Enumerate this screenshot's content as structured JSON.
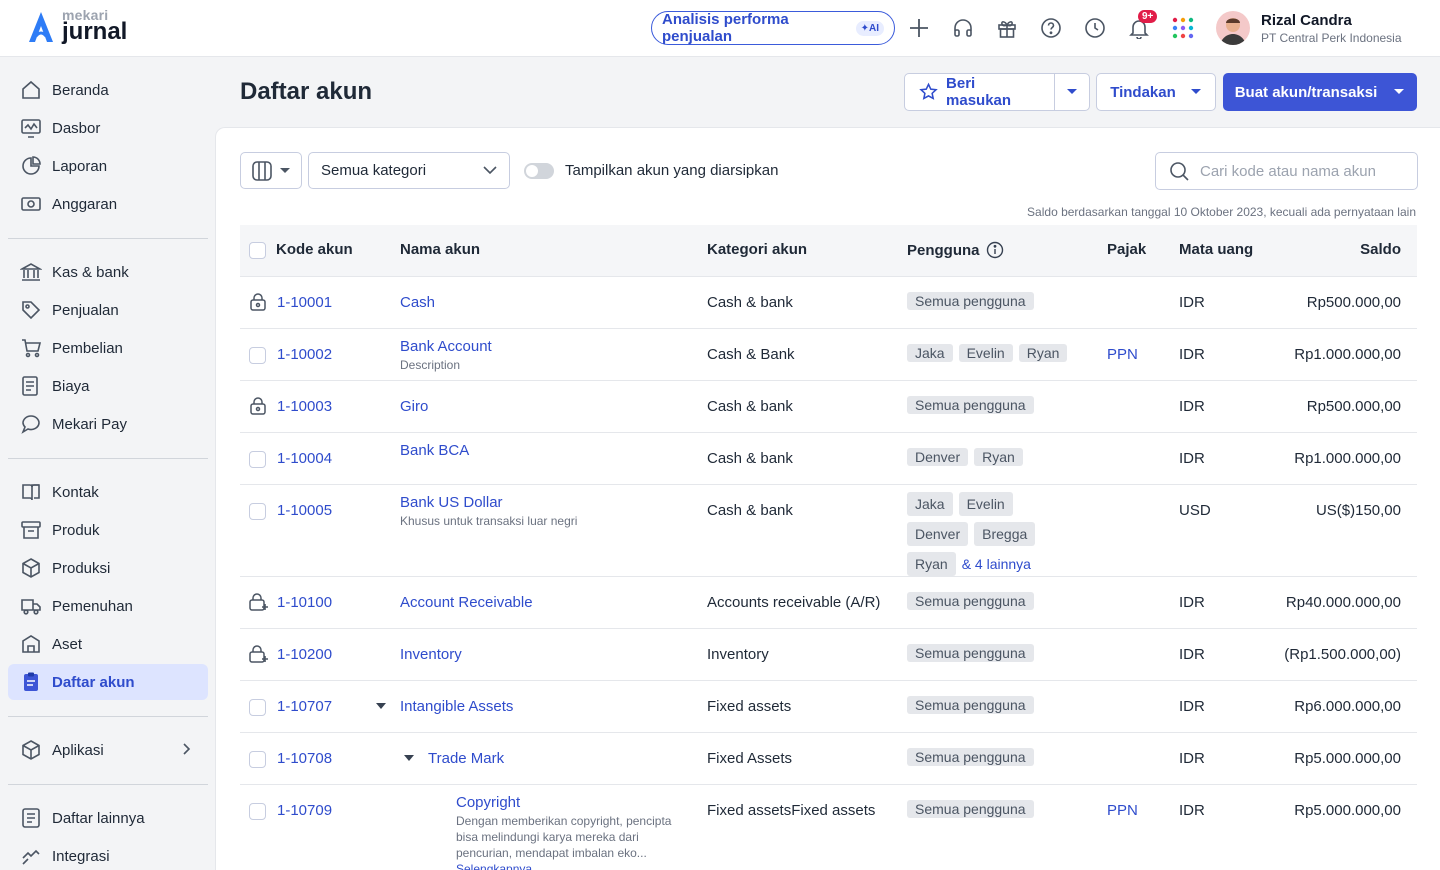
{
  "header": {
    "logo_small": "mekari",
    "logo_big": "jurnal",
    "ai_label": "Analisis performa penjualan",
    "ai_badge": "✦AI",
    "notif_count": "9+",
    "user_name": "Rizal Candra",
    "user_company": "PT Central Perk Indonesia"
  },
  "sidebar": {
    "items": [
      {
        "label": "Beranda",
        "icon": "home-icon"
      },
      {
        "label": "Dasbor",
        "icon": "dashboard-icon"
      },
      {
        "label": "Laporan",
        "icon": "report-icon"
      },
      {
        "label": "Anggaran",
        "icon": "budget-icon"
      },
      {
        "label": "Kas & bank",
        "icon": "bank-icon"
      },
      {
        "label": "Penjualan",
        "icon": "sales-tag-icon"
      },
      {
        "label": "Pembelian",
        "icon": "cart-icon"
      },
      {
        "label": "Biaya",
        "icon": "expense-icon"
      },
      {
        "label": "Mekari Pay",
        "icon": "chat-pay-icon"
      },
      {
        "label": "Kontak",
        "icon": "contact-book-icon"
      },
      {
        "label": "Produk",
        "icon": "product-box-icon"
      },
      {
        "label": "Produksi",
        "icon": "production-cube-icon"
      },
      {
        "label": "Pemenuhan",
        "icon": "truck-icon"
      },
      {
        "label": "Aset",
        "icon": "asset-building-icon"
      },
      {
        "label": "Daftar akun",
        "icon": "clipboard-icon"
      },
      {
        "label": "Aplikasi",
        "icon": "apps-cube-icon"
      },
      {
        "label": "Daftar lainnya",
        "icon": "list-doc-icon"
      },
      {
        "label": "Integrasi",
        "icon": "integration-icon"
      }
    ]
  },
  "page": {
    "title": "Daftar akun",
    "feedback_label": "Beri masukan",
    "actions_label": "Tindakan",
    "create_label": "Buat akun/transaksi"
  },
  "filters": {
    "category": "Semua kategori",
    "archive_toggle_label": "Tampilkan akun yang diarsipkan",
    "archive_toggle_on": false,
    "search_placeholder": "Cari kode atau nama akun",
    "balance_note": "Saldo berdasarkan tanggal 10 Oktober 2023, kecuali ada pernyataan lain"
  },
  "table": {
    "columns": {
      "code": "Kode akun",
      "name": "Nama akun",
      "category": "Kategori akun",
      "users": "Pengguna",
      "tax": "Pajak",
      "currency": "Mata uang",
      "balance": "Saldo"
    },
    "rows": [
      {
        "code": "1-10001",
        "name": "Cash",
        "desc": "",
        "category": "Cash & bank",
        "users": [
          "Semua pengguna"
        ],
        "more": "",
        "tax": "",
        "currency": "IDR",
        "balance": "Rp500.000,00",
        "marker": "lock"
      },
      {
        "code": "1-10002",
        "name": "Bank Account",
        "desc": "Description",
        "category": "Cash & Bank",
        "users": [
          "Jaka",
          "Evelin",
          "Ryan"
        ],
        "more": "",
        "tax": "PPN",
        "currency": "IDR",
        "balance": "Rp1.000.000,00",
        "marker": "checkbox"
      },
      {
        "code": "1-10003",
        "name": "Giro",
        "desc": "",
        "category": "Cash & bank",
        "users": [
          "Semua pengguna"
        ],
        "more": "",
        "tax": "",
        "currency": "IDR",
        "balance": "Rp500.000,00",
        "marker": "lock"
      },
      {
        "code": "1-10004",
        "name": "Bank BCA",
        "desc": "",
        "category": "Cash & bank",
        "users": [
          "Denver",
          "Ryan"
        ],
        "more": "",
        "tax": "",
        "currency": "IDR",
        "balance": "Rp1.000.000,00",
        "marker": "checkbox"
      },
      {
        "code": "1-10005",
        "name": "Bank US Dollar",
        "desc": "Khusus untuk transaksi luar negri",
        "category": "Cash & bank",
        "users": [
          "Jaka",
          "Evelin",
          "Denver",
          "Bregga",
          "Ryan"
        ],
        "more": "& 4 lainnya",
        "tax": "",
        "currency": "USD",
        "balance": "US($)150,00",
        "marker": "checkbox"
      },
      {
        "code": "1-10100",
        "name": "Account Receivable",
        "desc": "",
        "category": "Accounts receivable (A/R)",
        "users": [
          "Semua pengguna"
        ],
        "more": "",
        "tax": "",
        "currency": "IDR",
        "balance": "Rp40.000.000,00",
        "marker": "lock-plus"
      },
      {
        "code": "1-10200",
        "name": "Inventory",
        "desc": "",
        "category": "Inventory",
        "users": [
          "Semua pengguna"
        ],
        "more": "",
        "tax": "",
        "currency": "IDR",
        "balance": "(Rp1.500.000,00)",
        "marker": "lock-plus"
      },
      {
        "code": "1-10707",
        "name": "Intangible Assets",
        "desc": "",
        "category": "Fixed assets",
        "users": [
          "Semua pengguna"
        ],
        "more": "",
        "tax": "",
        "currency": "IDR",
        "balance": "Rp6.000.000,00",
        "marker": "checkbox"
      },
      {
        "code": "1-10708",
        "name": "Trade Mark",
        "desc": "",
        "category": "Fixed Assets",
        "users": [
          "Semua pengguna"
        ],
        "more": "",
        "tax": "",
        "currency": "IDR",
        "balance": "Rp5.000.000,00",
        "marker": "checkbox"
      },
      {
        "code": "1-10709",
        "name": "Copyright",
        "desc": "Dengan memberikan copyright, pencipta bisa melindungi karya mereka dari pencurian, mendapat imbalan eko...",
        "desc_link": "Selengkapnya",
        "category": "Fixed assetsFixed assets",
        "users": [
          "Semua pengguna"
        ],
        "more": "",
        "tax": "PPN",
        "currency": "IDR",
        "balance": "Rp5.000.000,00",
        "marker": "checkbox"
      }
    ]
  }
}
